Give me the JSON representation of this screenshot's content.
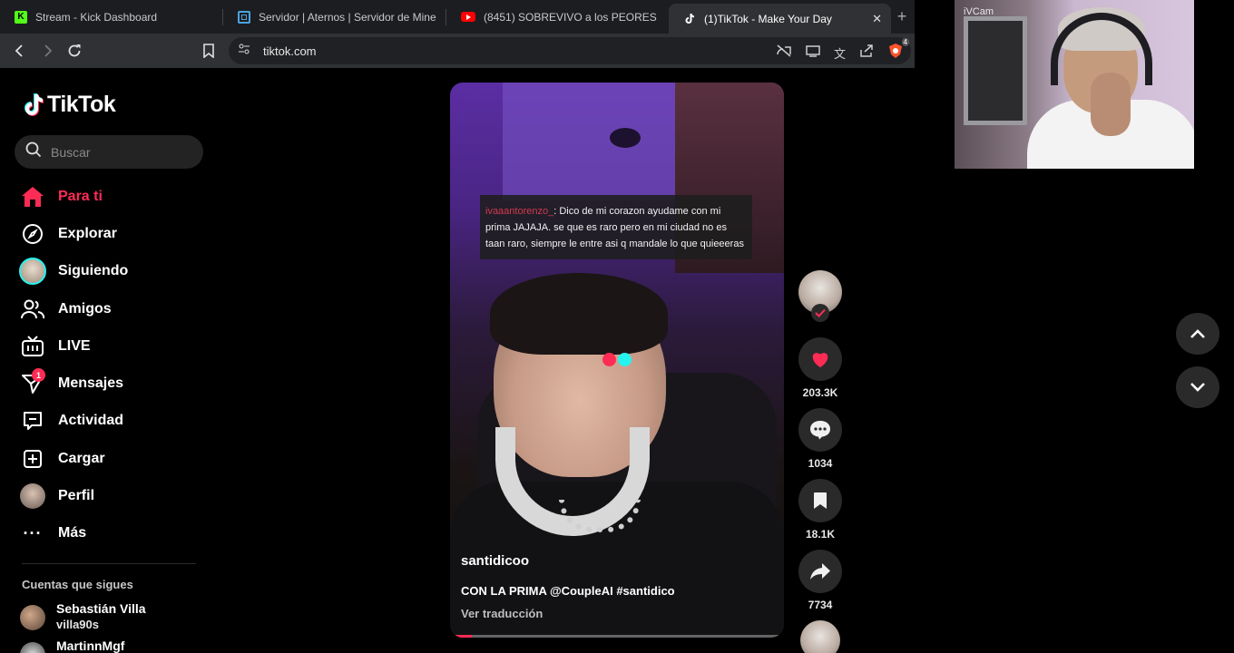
{
  "browser": {
    "tabs": [
      {
        "title": "Stream - Kick Dashboard",
        "active": false,
        "icon": "kick-icon"
      },
      {
        "title": "Servidor | Aternos | Servidor de Mine",
        "active": false,
        "icon": "aternos-icon"
      },
      {
        "title": "(8451) SOBREVIVO a los PEORES RITU",
        "active": false,
        "icon": "youtube-icon"
      },
      {
        "title": "(1)TikTok - Make Your Day",
        "active": true,
        "icon": "tiktok-icon"
      }
    ],
    "url": "tiktok.com",
    "shield_count": "4"
  },
  "sidebar": {
    "logo_text": "TikTok",
    "search_placeholder": "Buscar",
    "menu": [
      {
        "label": "Para ti",
        "icon": "home-icon",
        "active": true
      },
      {
        "label": "Explorar",
        "icon": "compass-icon"
      },
      {
        "label": "Siguiendo",
        "icon": "following-avatar-icon"
      },
      {
        "label": "Amigos",
        "icon": "friends-icon"
      },
      {
        "label": "LIVE",
        "icon": "live-icon"
      },
      {
        "label": "Mensajes",
        "icon": "messages-icon",
        "badge": "1"
      },
      {
        "label": "Actividad",
        "icon": "activity-icon"
      },
      {
        "label": "Cargar",
        "icon": "upload-icon"
      },
      {
        "label": "Perfil",
        "icon": "profile-avatar-icon"
      },
      {
        "label": "Más",
        "icon": "more-icon"
      }
    ],
    "following_title": "Cuentas que sigues",
    "accounts": [
      {
        "name": "Sebastián Villa",
        "username": "villa90s"
      },
      {
        "name": "MartinnMgf",
        "username": ""
      }
    ]
  },
  "video": {
    "comment_user": "ivaaantorenzo_",
    "comment_text": ": Dico de mi corazon ayudame con mi prima JAJAJA. se que es raro pero en mi ciudad no es taan raro, siempre le entre asi q mandale lo que quieeeras",
    "author": "santidicoo",
    "caption": "CON LA PRIMA @CoupleAI #santidico",
    "translate_label": "Ver traducción",
    "progress": 0.05
  },
  "actions": {
    "likes": "203.3K",
    "comments": "1034",
    "saves": "18.1K",
    "shares": "7734"
  },
  "webcam": {
    "label": "iVCam"
  },
  "colors": {
    "accent": "#fe2c55",
    "background": "#000000",
    "tiktok_cyan": "#25f4ee"
  }
}
